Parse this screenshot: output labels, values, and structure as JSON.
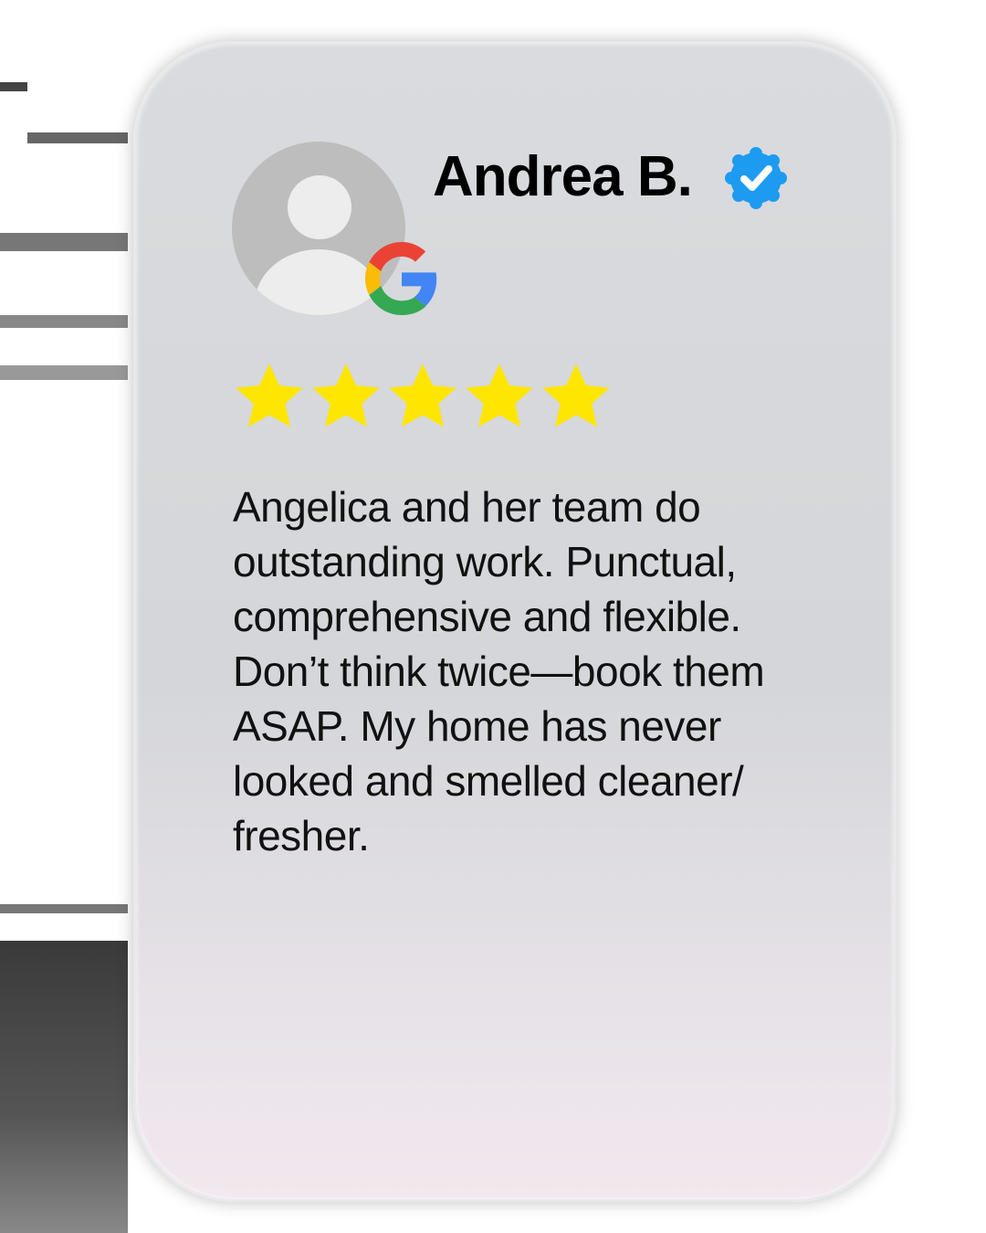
{
  "reviewer": {
    "name": "Andrea B.",
    "verified": true,
    "source_icon": "google-g-icon",
    "avatar_icon": "default-user-avatar-icon"
  },
  "rating": {
    "value": 5,
    "max": 5,
    "star_color": "#FFE600"
  },
  "review_text": "Angelica and her team do outstanding work. Punctual, comprehensive and flexible. Don’t think twice—book them ASAP. My home has never looked and smelled cleaner/ fresher.",
  "colors": {
    "verified_badge": "#1D9BF0"
  }
}
